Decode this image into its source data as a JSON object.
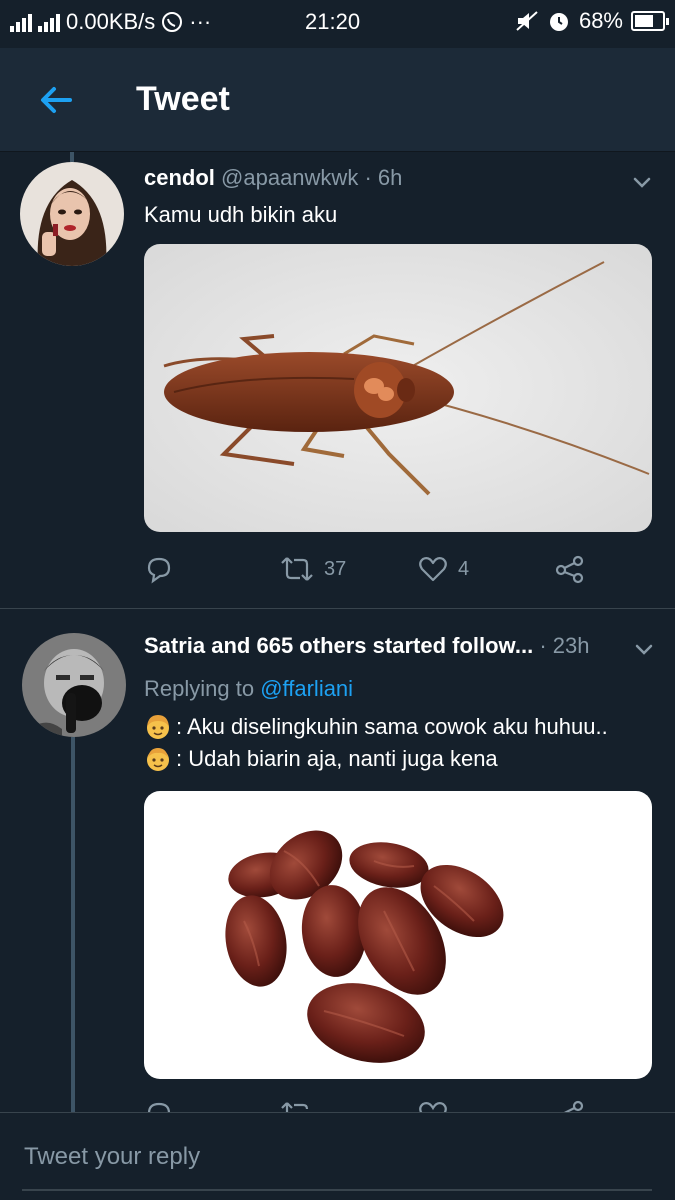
{
  "status_bar": {
    "network_speed": "0.00KB/s",
    "time": "21:20",
    "battery": "68%"
  },
  "header": {
    "title": "Tweet"
  },
  "tweets": [
    {
      "name": "cendol",
      "handle": "@apaanwkwk",
      "time": "· 6h",
      "text": "Kamu udh bikin aku",
      "media_subject": "cockroach",
      "actions": {
        "reply_count": "",
        "retweet_count": "37",
        "like_count": "4"
      }
    },
    {
      "name": "Satria and 665 others started follow...",
      "time": "· 23h",
      "replying_prefix": "Replying to",
      "replying_handle": "@ffarliani",
      "lines": [
        ": Aku diselingkuhin sama cowok aku huhuu..",
        ": Udah biarin aja, nanti juga kena"
      ],
      "media_subject": "dates fruit"
    }
  ],
  "reply": {
    "placeholder": "Tweet your reply"
  },
  "colors": {
    "background": "#15202b",
    "header": "#1c2a38",
    "accent": "#1da1f2",
    "muted": "#8899a6"
  }
}
